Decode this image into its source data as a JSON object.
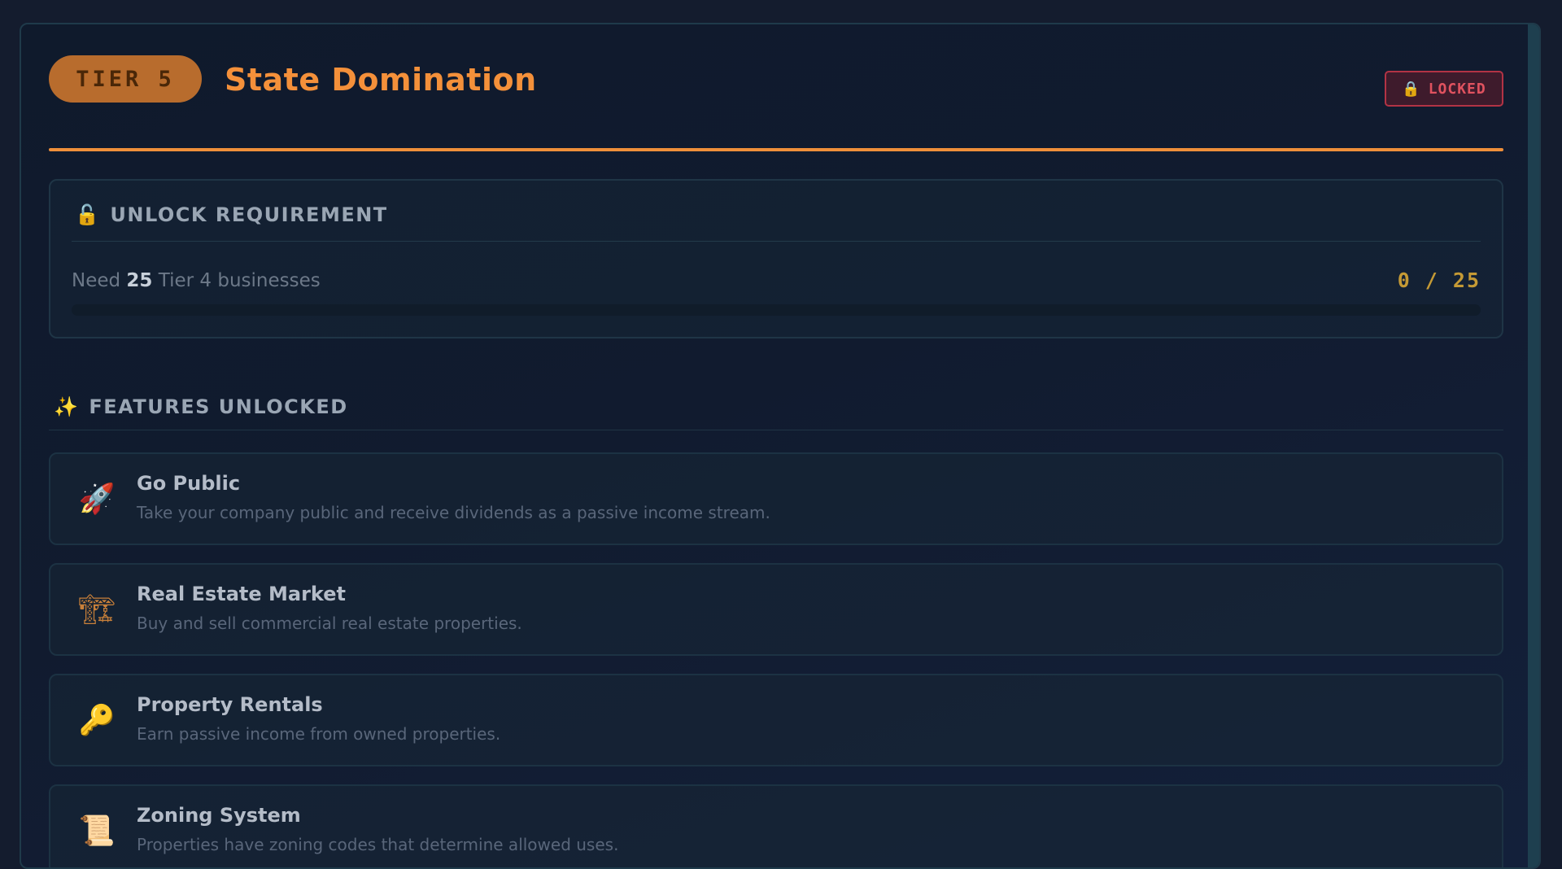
{
  "header": {
    "tier_label": "TIER 5",
    "title": "State Domination",
    "status_label": "LOCKED"
  },
  "requirement": {
    "heading": "UNLOCK REQUIREMENT",
    "text_prefix": "Need",
    "count_required": "25",
    "text_suffix": "Tier 4 businesses",
    "progress_text": "0 / 25",
    "progress_fraction": 0
  },
  "features": {
    "heading": "FEATURES UNLOCKED",
    "items": [
      {
        "name": "Go Public",
        "description": "Take your company public and receive dividends as a passive income stream.",
        "icon": "rocket-icon"
      },
      {
        "name": "Real Estate Market",
        "description": "Buy and sell commercial real estate properties.",
        "icon": "crane-icon"
      },
      {
        "name": "Property Rentals",
        "description": "Earn passive income from owned properties.",
        "icon": "key-icon"
      },
      {
        "name": "Zoning System",
        "description": "Properties have zoning codes that determine allowed uses.",
        "icon": "scroll-icon"
      }
    ]
  },
  "colors": {
    "accent": "#ef8f3a",
    "title": "#f4903a",
    "locked": "#e0525f",
    "progress_count": "#c59a35"
  }
}
